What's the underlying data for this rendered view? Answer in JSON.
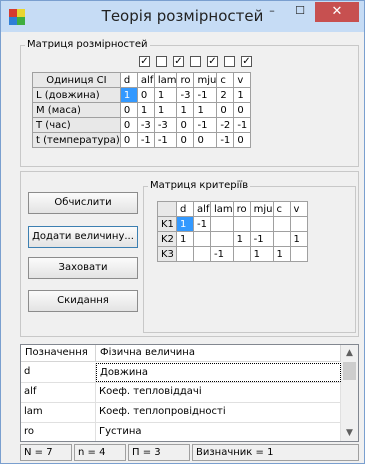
{
  "window": {
    "title": "Теорія розмірностей",
    "minimize_glyph": "–",
    "maximize_glyph": "☐",
    "close_glyph": "✕",
    "icon": "app-blocks-icon",
    "colors": {
      "titlebar": "#c6dcf5",
      "close": "#c75050",
      "selection": "#3399ff"
    }
  },
  "dimension_matrix": {
    "title": "Матриця розмірностей",
    "checkboxes": [
      true,
      false,
      true,
      false,
      true,
      false,
      true
    ],
    "check_glyph": "✓",
    "header": [
      "Одиниця СІ",
      "d",
      "alf",
      "lam",
      "ro",
      "mju",
      "c",
      "v"
    ],
    "rows": [
      {
        "label": "L (довжина)",
        "values": [
          "1",
          "0",
          "1",
          "-3",
          "-1",
          "2",
          "1"
        ]
      },
      {
        "label": "M (маса)",
        "values": [
          "0",
          "1",
          "1",
          "1",
          "1",
          "0",
          "0"
        ]
      },
      {
        "label": "T (час)",
        "values": [
          "0",
          "-3",
          "-3",
          "0",
          "-1",
          "-2",
          "-1"
        ]
      },
      {
        "label": "t (температура)",
        "values": [
          "0",
          "-1",
          "-1",
          "0",
          "0",
          "-1",
          "0"
        ]
      }
    ]
  },
  "buttons": {
    "compute": "Обчислити",
    "add_quantity": "Додати величину...",
    "hide": "Заховати",
    "reset": "Скидання"
  },
  "criteria_matrix": {
    "title": "Матриця критеріїв",
    "header": [
      "",
      "d",
      "alf",
      "lam",
      "ro",
      "mju",
      "c",
      "v"
    ],
    "rows": [
      {
        "label": "K1",
        "values": [
          "1",
          "-1",
          "",
          "",
          "",
          "",
          ""
        ]
      },
      {
        "label": "K2",
        "values": [
          "1",
          "",
          "",
          "1",
          "-1",
          "",
          "1"
        ]
      },
      {
        "label": "K3",
        "values": [
          "",
          "",
          "-1",
          "",
          "1",
          "1",
          ""
        ]
      }
    ]
  },
  "quantities": {
    "columns": [
      "Позначення",
      "Фізична величина"
    ],
    "rows": [
      {
        "symbol": "d",
        "name": "Довжина"
      },
      {
        "symbol": "alf",
        "name": "Коеф. тепловіддачі"
      },
      {
        "symbol": "lam",
        "name": "Коеф. теплопровідності"
      },
      {
        "symbol": "ro",
        "name": "Густина"
      }
    ],
    "scroll_up_glyph": "▲",
    "scroll_down_glyph": "▼"
  },
  "status": {
    "n": "N = 7",
    "nn": "n = 4",
    "pi": "П = 3",
    "det": "Визначник = 1"
  }
}
